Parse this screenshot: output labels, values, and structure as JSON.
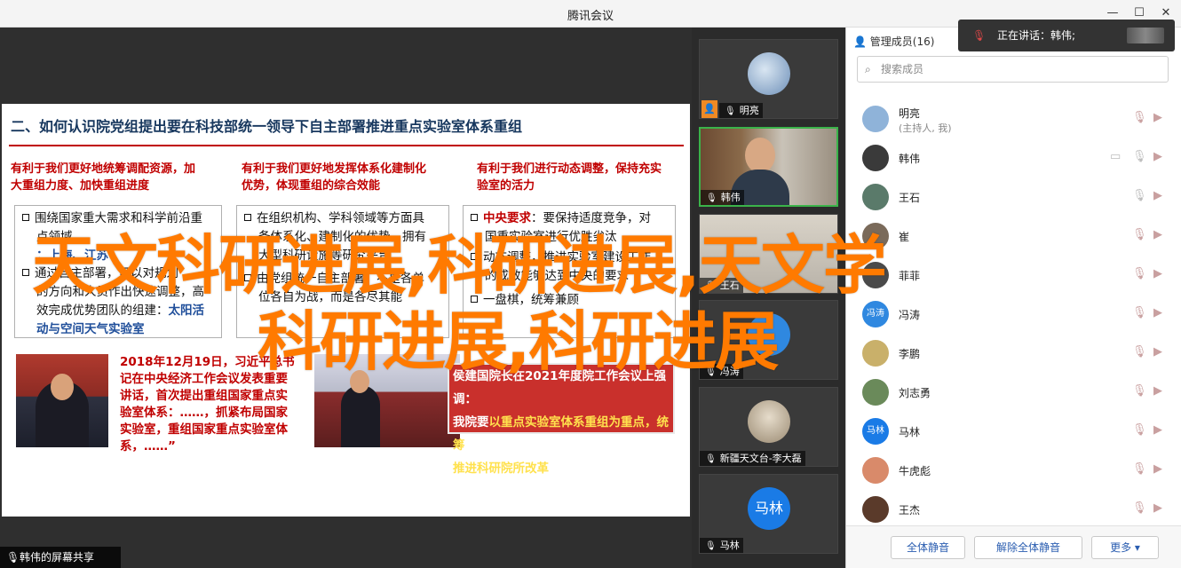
{
  "window": {
    "title": "腾讯会议"
  },
  "slide": {
    "title": "二、如何认识院党组提出要在科技部统一领导下自主部署推进重点实验室体系重组",
    "col1": {
      "head1": "有利于我们更好地统筹调配资源，加",
      "head2": "大重组力度、加快重组进度",
      "b1l1": "围绕国家重大需求和科学前沿重",
      "b1l2": "点领域",
      "b1l3": "：上海、江苏",
      "b2l1": "通过自主部署，可以对规划",
      "b2l2": "的方向和人员作出快速调整，高",
      "b2l3": "效完成优势团队的组建：",
      "b2l3b": "太阳活",
      "b2l4": "动与空间天气实验室"
    },
    "col2": {
      "head1": "有利于我们更好地发挥体系化建制化",
      "head2": "优势，体现重组的综合效能",
      "b1l1": "在组织机构、学科领域等方面具",
      "b1l2": "备体系化、建制化的优势，拥有",
      "b1l3": "大型科研设施等研究平台",
      "b2l1": "由党组统一自主部署，不是各单",
      "b2l2": "位各自为战，而是各尽其能"
    },
    "col3": {
      "head1": "有利于我们进行动态调整，保持充实",
      "head2": "验室的活力",
      "b1a": "中央要求",
      "b1b": "：要保持适度竞争，对",
      "b1l2": "国重实验室进行优胜劣汰",
      "b2l1": "动态调整，推进实验室建设工作",
      "b2l2": "的成效能够达到中央的要求",
      "b3l1": "一盘棋，统筹兼顾"
    },
    "caption1": {
      "l1": "2018年12月19日，习近平总书",
      "l2": "记在中央经济工作会议发表重要",
      "l3": "讲话，首次提出重组国家重点实",
      "l4": "验室体系：……，抓紧布局国家",
      "l5": "实验室，重组国家重点实验室体",
      "l6": "系，……”"
    },
    "quote": {
      "l1": "侯建国院长在2021年度院工作会议上强调：",
      "l2a": "我院要",
      "l2b": "以重点实验室体系重组为重点，统筹",
      "l3": "推进科研院所改革"
    }
  },
  "share_tag": "韩伟的屏幕共享",
  "watermark": {
    "line1": "天文科研进展,科研进展,天文学",
    "line2": "科研进展,科研进展"
  },
  "videos": [
    {
      "name": "明亮",
      "avatar_color": "#8fb3d9"
    },
    {
      "name": "韩伟",
      "avatar_color": "#6b5a48"
    },
    {
      "name": "王石",
      "avatar_color": "#c9b99a"
    },
    {
      "name": "冯涛",
      "avatar_color": "#2f88e0"
    },
    {
      "name": "新疆天文台-李大磊",
      "avatar_color": "#bda88f"
    },
    {
      "name": "马林",
      "avatar_color": "#1a7be6",
      "avatar_text": "马林"
    }
  ],
  "members": {
    "header": "管理成员(16)",
    "search_placeholder": "搜索成员",
    "list": [
      {
        "name": "明亮",
        "sub": "(主持人, 我)",
        "color": "#8fb3d9",
        "av": ""
      },
      {
        "name": "韩伟",
        "sub": "",
        "color": "#3a3a3a",
        "av": ""
      },
      {
        "name": "王石",
        "sub": "",
        "color": "#5a7a6a",
        "av": ""
      },
      {
        "name": "崔",
        "sub": "",
        "color": "#7a6a5a",
        "av": ""
      },
      {
        "name": "菲菲",
        "sub": "",
        "color": "#4a4a4a",
        "av": ""
      },
      {
        "name": "冯涛",
        "sub": "",
        "color": "#2f88e0",
        "av": "冯涛"
      },
      {
        "name": "李鹏",
        "sub": "",
        "color": "#c9b06a",
        "av": ""
      },
      {
        "name": "刘志勇",
        "sub": "",
        "color": "#6a8a5a",
        "av": ""
      },
      {
        "name": "马林",
        "sub": "",
        "color": "#1a7be6",
        "av": "马林"
      },
      {
        "name": "牛虎彪",
        "sub": "",
        "color": "#d98a6a",
        "av": ""
      },
      {
        "name": "王杰",
        "sub": "",
        "color": "#5a3a2a",
        "av": ""
      }
    ],
    "btn_mute_all": "全体静音",
    "btn_unmute_all": "解除全体静音",
    "btn_more": "更多 ▾"
  },
  "toast": {
    "text": "正在讲话：韩伟;"
  }
}
